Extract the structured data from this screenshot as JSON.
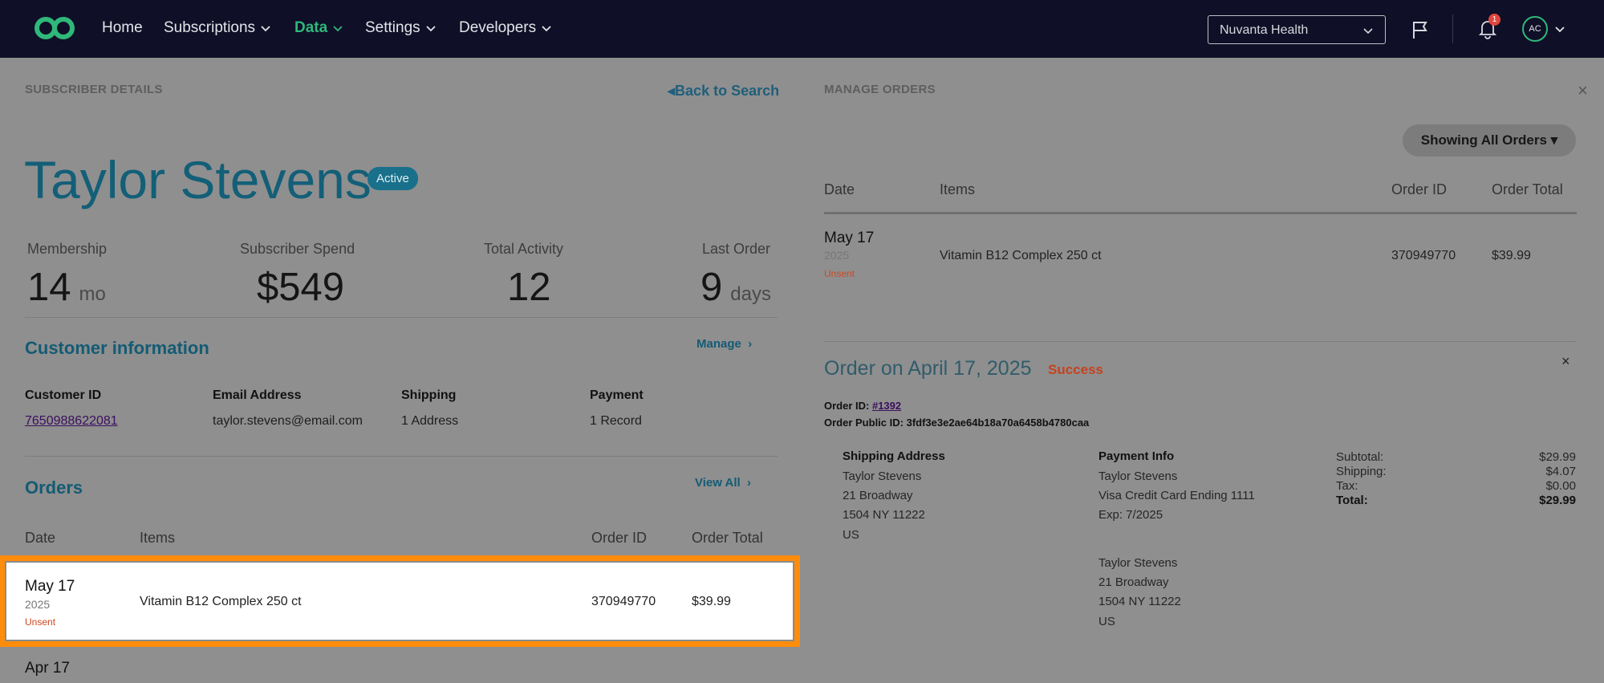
{
  "nav": {
    "items": [
      {
        "label": "Home",
        "dropdown": false
      },
      {
        "label": "Subscriptions",
        "dropdown": true
      },
      {
        "label": "Data",
        "dropdown": true,
        "active": true
      },
      {
        "label": "Settings",
        "dropdown": true
      },
      {
        "label": "Developers",
        "dropdown": true
      }
    ],
    "org_select": "Nuvanta Health",
    "notification_count": "1",
    "avatar_initials": "AC"
  },
  "subscriber": {
    "section_label": "SUBSCRIBER DETAILS",
    "back_link": "Back to Search",
    "name": "Taylor Stevens",
    "status": "Active",
    "stats": [
      {
        "label": "Membership",
        "value": "14",
        "unit": "mo"
      },
      {
        "label": "Subscriber Spend",
        "value": "$549",
        "unit": ""
      },
      {
        "label": "Total Activity",
        "value": "12",
        "unit": ""
      },
      {
        "label": "Last Order",
        "value": "9",
        "unit": "days"
      }
    ],
    "customer_info": {
      "heading": "Customer information",
      "manage_link": "Manage",
      "fields": [
        {
          "label": "Customer ID",
          "value": "7650988622081"
        },
        {
          "label": "Email Address",
          "value": "taylor.stevens@email.com"
        },
        {
          "label": "Shipping",
          "value": "1 Address"
        },
        {
          "label": "Payment",
          "value": "1 Record"
        }
      ]
    },
    "orders": {
      "heading": "Orders",
      "view_all": "View All",
      "columns": [
        "Date",
        "Items",
        "Order ID",
        "Order Total"
      ],
      "rows": [
        {
          "date": "May 17",
          "year": "2025",
          "status": "Unsent",
          "items": "Vitamin B12 Complex 250 ct",
          "order_id": "370949770",
          "total": "$39.99"
        },
        {
          "date": "Apr 17"
        }
      ]
    }
  },
  "manage_orders": {
    "section_label": "MANAGE ORDERS",
    "filter": "Showing All Orders",
    "columns": [
      "Date",
      "Items",
      "Order ID",
      "Order Total"
    ],
    "rows": [
      {
        "date": "May 17",
        "year": "2025",
        "status": "Unsent",
        "items": "Vitamin B12 Complex 250 ct",
        "order_id": "370949770",
        "total": "$39.99"
      }
    ],
    "detail": {
      "title": "Order on April 17, 2025",
      "status": "Success",
      "order_id_label": "Order ID:",
      "order_id": "#1392",
      "public_id_label": "Order Public ID:",
      "public_id": "3fdf3e3e2ae64b18a70a6458b4780caa",
      "shipping": {
        "heading": "Shipping Address",
        "lines": [
          "Taylor Stevens",
          "21 Broadway",
          "1504 NY 11222",
          "US"
        ]
      },
      "payment": {
        "heading": "Payment Info",
        "lines": [
          "Taylor Stevens",
          "Visa Credit Card Ending 1111",
          "Exp: 7/2025"
        ]
      },
      "billing": {
        "lines": [
          "Taylor Stevens",
          "21 Broadway",
          "1504 NY 11222",
          "US"
        ]
      },
      "totals": [
        {
          "label": "Subtotal:",
          "value": "$29.99"
        },
        {
          "label": "Shipping:",
          "value": "$4.07"
        },
        {
          "label": "Tax:",
          "value": "$0.00"
        },
        {
          "label": "Total:",
          "value": "$29.99"
        }
      ]
    }
  },
  "colors": {
    "nav_bg": "#0f0f27",
    "accent_green": "#2fb87a",
    "brand_teal": "#135f78",
    "highlight": "#ff8c0a",
    "unsent": "#d1481f"
  }
}
